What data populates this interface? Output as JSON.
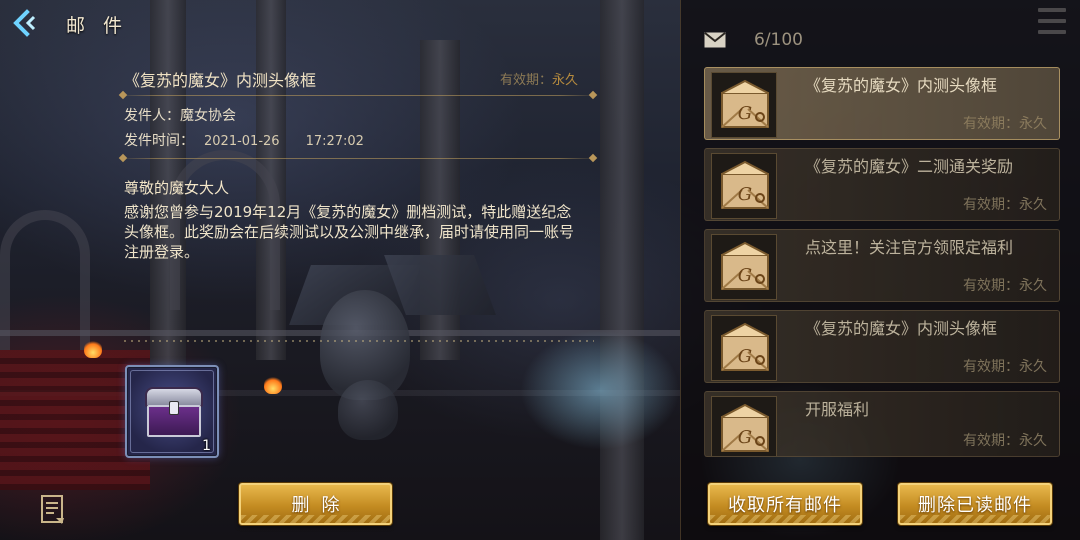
{
  "header": {
    "title": "邮 件"
  },
  "detail": {
    "subject": "《复苏的魔女》内测头像框",
    "validity_label": "有效期：",
    "validity_value": "永久",
    "sender_label": "发件人：",
    "sender": "魔女协会",
    "time_label": "发件时间：",
    "date": "2021-01-26",
    "time": "17:27:02",
    "greeting": "尊敬的魔女大人",
    "body": "感谢您曾参与2019年12月《复苏的魔女》删档测试，特此赠送纪念头像框。此奖励会在后续测试以及公测中继承，届时请使用同一账号注册登录。",
    "attachment_count": "1",
    "delete_label": "删除"
  },
  "mailbox": {
    "count": "6/100",
    "items": [
      {
        "title": "《复苏的魔女》内测头像框",
        "validity": "有效期：永久"
      },
      {
        "title": "《复苏的魔女》二测通关奖励",
        "validity": "有效期：永久"
      },
      {
        "title": "点这里！关注官方领限定福利",
        "validity": "有效期：永久"
      },
      {
        "title": "《复苏的魔女》内测头像框",
        "validity": "有效期：永久"
      },
      {
        "title": "开服福利",
        "validity": "有效期：永久"
      }
    ],
    "collect_all_label": "收取所有邮件",
    "delete_read_label": "删除已读邮件"
  }
}
